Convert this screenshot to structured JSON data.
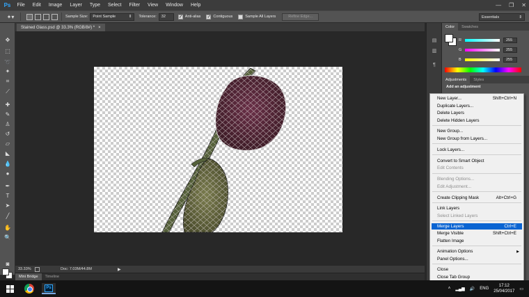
{
  "app": {
    "logo": "Ps"
  },
  "menu": [
    "File",
    "Edit",
    "Image",
    "Layer",
    "Type",
    "Select",
    "Filter",
    "View",
    "Window",
    "Help"
  ],
  "window_controls": {
    "minimize": "—",
    "restore": "❐",
    "close": "✕"
  },
  "options": {
    "tool_icon": "magic-wand-icon",
    "sample_size_label": "Sample Size:",
    "sample_size_value": "Point Sample",
    "tolerance_label": "Tolerance:",
    "tolerance_value": "32",
    "anti_alias_label": "Anti-alias",
    "contiguous_label": "Contiguous",
    "sample_all_layers_label": "Sample All Layers",
    "refine_edge_label": "Refine Edge...",
    "workspace_value": "Essentials"
  },
  "document": {
    "tab_title": "Stained Glass.psd @ 33.3% (RGB/8#) *",
    "tab_close": "×"
  },
  "status": {
    "zoom": "33.33%",
    "doc_size": "Doc: 7.03M/44.8M",
    "arrow": "▶"
  },
  "bottom_tabs": [
    "Mini Bridge",
    "Timeline"
  ],
  "color_panel": {
    "tabs": [
      "Color",
      "Swatches"
    ],
    "r_label": "R",
    "g_label": "G",
    "b_label": "B",
    "r_value": "255",
    "g_value": "255",
    "b_value": "255"
  },
  "adjustments_panel": {
    "tabs": [
      "Adjustments",
      "Styles"
    ],
    "title": "Add an adjustment"
  },
  "context_menu": {
    "items": [
      {
        "label": "New Layer...",
        "shortcut": "Shift+Ctrl+N"
      },
      {
        "label": "Duplicate Layers..."
      },
      {
        "label": "Delete Layers"
      },
      {
        "label": "Delete Hidden Layers"
      },
      {
        "label": "New Group..."
      },
      {
        "label": "New Group from Layers..."
      },
      {
        "label": "Lock Layers..."
      },
      {
        "label": "Convert to Smart Object"
      },
      {
        "label": "Edit Contents",
        "disabled": true
      },
      {
        "label": "Blending Options...",
        "disabled": true
      },
      {
        "label": "Edit Adjustment...",
        "disabled": true
      },
      {
        "label": "Create Clipping Mask",
        "shortcut": "Alt+Ctrl+G"
      },
      {
        "label": "Link Layers"
      },
      {
        "label": "Select Linked Layers",
        "disabled": true
      },
      {
        "label": "Merge Layers",
        "shortcut": "Ctrl+E",
        "highlighted": true
      },
      {
        "label": "Merge Visible",
        "shortcut": "Shift+Ctrl+E"
      },
      {
        "label": "Flatten Image"
      },
      {
        "label": "Animation Options",
        "submenu": "▶"
      },
      {
        "label": "Panel Options..."
      },
      {
        "label": "Close"
      },
      {
        "label": "Close Tab Group"
      }
    ]
  },
  "taskbar": {
    "tray_arrow": "˄",
    "language": "ENG",
    "time": "17:12",
    "date": "25/04/2017"
  }
}
